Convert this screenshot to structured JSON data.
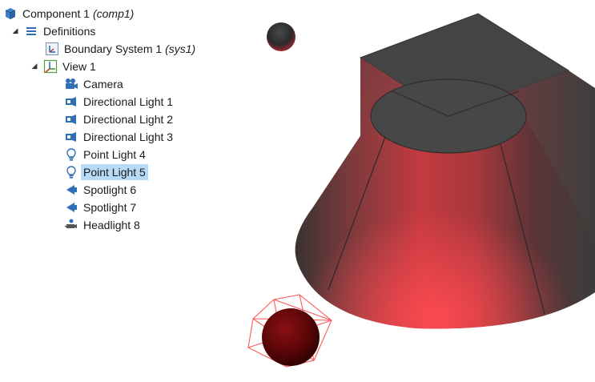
{
  "tree": {
    "component": {
      "label": "Component 1",
      "tag": "(comp1)",
      "icon": "component-cube-icon"
    },
    "definitions": {
      "label": "Definitions",
      "icon": "definitions-list-icon"
    },
    "boundary_system": {
      "label": "Boundary System 1",
      "tag": "(sys1)",
      "icon": "boundary-system-icon"
    },
    "view": {
      "label": "View 1",
      "icon": "view-axes-icon"
    },
    "items": [
      {
        "label": "Camera",
        "icon": "camera-icon"
      },
      {
        "label": "Directional Light 1",
        "icon": "directional-light-icon"
      },
      {
        "label": "Directional Light 2",
        "icon": "directional-light-icon"
      },
      {
        "label": "Directional Light 3",
        "icon": "directional-light-icon"
      },
      {
        "label": "Point Light 4",
        "icon": "point-light-bulb-icon"
      },
      {
        "label": "Point Light 5",
        "icon": "point-light-bulb-icon",
        "selected": true
      },
      {
        "label": "Spotlight 6",
        "icon": "spotlight-icon"
      },
      {
        "label": "Spotlight 7",
        "icon": "spotlight-icon"
      },
      {
        "label": "Headlight 8",
        "icon": "headlight-icon"
      }
    ]
  },
  "colors": {
    "selection": "#b7daf6",
    "geometry_red": "#d9343c",
    "geometry_dark": "#3c3c3c",
    "icon_blue": "#2f6fb5"
  }
}
